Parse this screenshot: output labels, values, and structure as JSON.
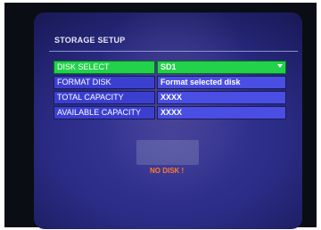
{
  "screen": {
    "title": "STORAGE SETUP",
    "status_message": "NO DISK !"
  },
  "settings": {
    "disk_select": {
      "label": "DISK SELECT",
      "value": "SD1"
    },
    "format_disk": {
      "label": "FORMAT DISK",
      "value": "Format selected disk"
    },
    "total_capacity": {
      "label": "TOTAL CAPACITY",
      "value": "XXXX"
    },
    "available_capacity": {
      "label": "AVAILABLE CAPACITY",
      "value": "XXXX"
    }
  },
  "colors": {
    "background": "#2b2c86",
    "row_label": "#3b3fd0",
    "row_value": "#4a4ee2",
    "selected_row": "#22d24a",
    "status_text": "#ff7a2e"
  }
}
